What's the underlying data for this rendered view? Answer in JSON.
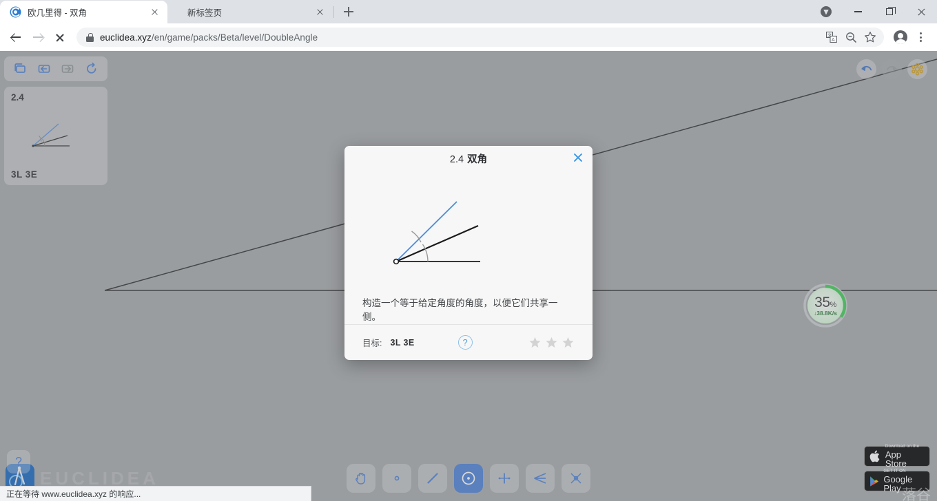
{
  "browser": {
    "tabs": [
      {
        "title": "欧几里得 - 双角",
        "favicon": "euclidea-logo-icon",
        "active": true
      },
      {
        "title": "新标签页",
        "favicon": "none",
        "active": false
      }
    ],
    "new_tab_label": "+",
    "nav": {
      "back_icon": "arrow-left-icon",
      "forward_icon": "arrow-right-icon",
      "stop_icon": "stop-icon"
    },
    "omnibox": {
      "lock_icon": "lock-icon",
      "url_host": "euclidea.xyz",
      "url_path": "/en/game/packs/Beta/level/DoubleAngle",
      "translate_icon": "translate-icon",
      "zoom_icon": "zoom-out-icon",
      "bookmark_icon": "star-outline-icon"
    },
    "profile_icon": "profile-avatar-icon",
    "menu_icon": "kebab-menu-icon",
    "window": {
      "badge_icon": "shield-badge-icon",
      "minimize_icon": "minimize-icon",
      "maximize_icon": "maximize-icon",
      "close_icon": "close-icon"
    }
  },
  "app": {
    "left_panel": {
      "toolbar_icons": [
        "levels-grid-icon",
        "previous-level-icon",
        "next-level-icon",
        "restart-icon"
      ],
      "level_number": "2.4",
      "level_rank": "3L  3E"
    },
    "top_right": {
      "undo_icon": "undo-icon",
      "redo_icon": "redo-icon",
      "settings_icon": "molecule-settings-icon"
    },
    "tools": [
      {
        "name": "pan-tool",
        "icon": "hand-icon",
        "active": false
      },
      {
        "name": "point-tool",
        "icon": "point-icon",
        "active": false
      },
      {
        "name": "line-tool",
        "icon": "line-icon",
        "active": false
      },
      {
        "name": "circle-tool",
        "icon": "circle-icon",
        "active": true
      },
      {
        "name": "perpendicular-bisector-tool",
        "icon": "perpendicular-bisector-icon",
        "active": false
      },
      {
        "name": "angle-bisector-tool",
        "icon": "angle-bisector-icon",
        "active": false
      },
      {
        "name": "intersection-tool",
        "icon": "intersection-icon",
        "active": false
      }
    ],
    "help_button_label": "?",
    "brand_text": "EUCLIDEA",
    "download_widget": {
      "percent": "35",
      "percent_unit": "%",
      "speed": "38.8K/s",
      "accent_color": "#3ecb54"
    },
    "store_badges": [
      {
        "small": "Download on the",
        "big": "App Store",
        "icon": "apple-icon"
      },
      {
        "small": "GET IT ON",
        "big": "Google Play",
        "icon": "google-play-icon"
      }
    ],
    "watermark": "落谷"
  },
  "dialog": {
    "title_number": "2.4",
    "title_name": "双角",
    "close_icon": "close-icon",
    "description": "构造一个等于给定角度的角度，以便它们共享一侧。",
    "goal_label": "目标:",
    "goal_value": "3L  3E",
    "help_icon": "question-mark-icon",
    "stars": [
      false,
      false,
      false
    ],
    "figure": {
      "line_color": "#1b1b1b",
      "target_color": "#4e8fe0",
      "arc_color": "#9a9a9a"
    }
  },
  "statusbar": {
    "text": "正在等待 www.euclidea.xyz 的响应..."
  }
}
